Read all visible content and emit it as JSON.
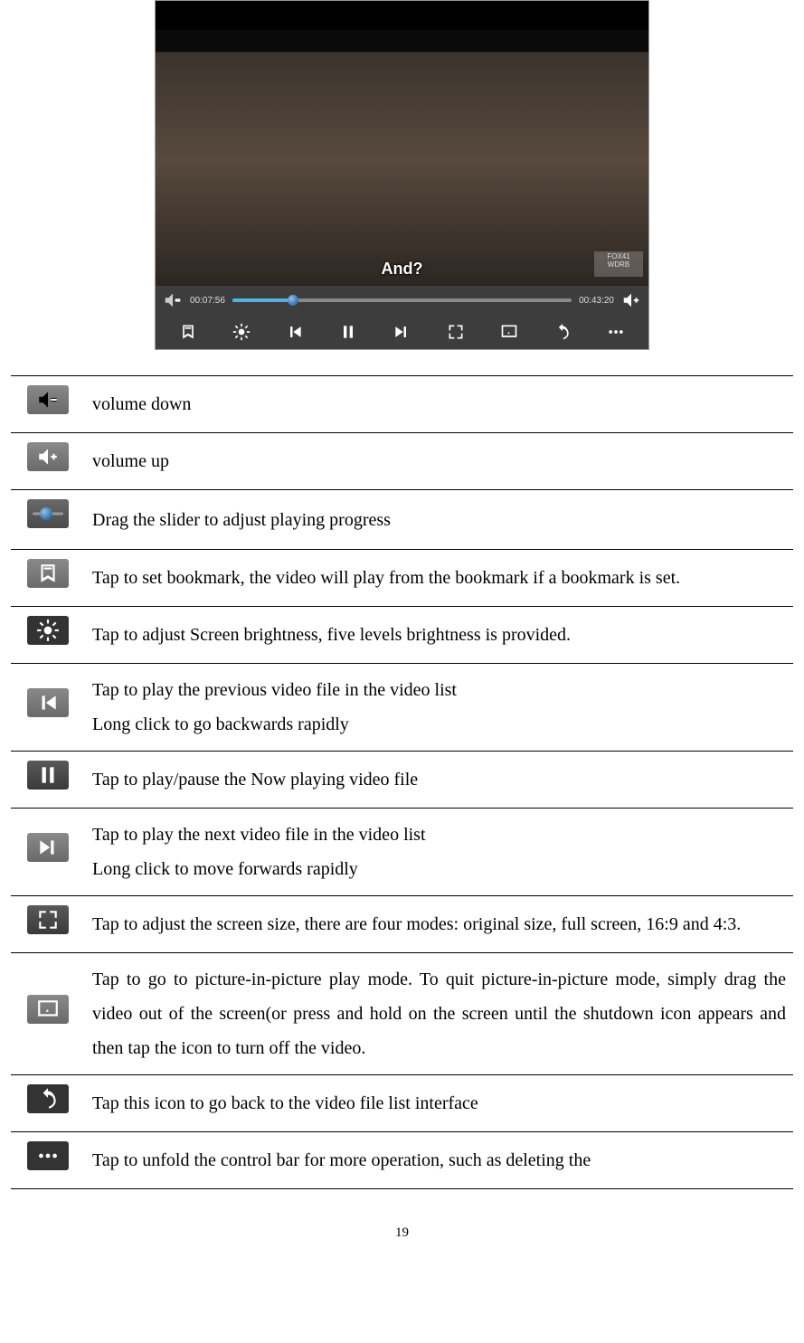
{
  "player": {
    "subtitle": "And?",
    "watermark_line1": "FOX41",
    "watermark_line2": "WDRB",
    "time_current": "00:07:56",
    "time_total": "00:43:20"
  },
  "rows": [
    {
      "icon": "volume-down-icon",
      "desc": "volume down"
    },
    {
      "icon": "volume-up-icon",
      "desc": "volume up"
    },
    {
      "icon": "progress-slider-icon",
      "desc": "Drag the slider to adjust playing progress"
    },
    {
      "icon": "bookmark-icon",
      "desc": "Tap to set bookmark, the video will play from the bookmark if a bookmark is set."
    },
    {
      "icon": "brightness-icon",
      "desc": "Tap to adjust Screen brightness, five levels brightness is provided."
    },
    {
      "icon": "previous-track-icon",
      "desc": "Tap to play the previous video file in the video list\nLong click to go backwards rapidly"
    },
    {
      "icon": "play-pause-icon",
      "desc": "Tap to play/pause the Now playing video file"
    },
    {
      "icon": "next-track-icon",
      "desc": "Tap to play the next video file in the video list\nLong click to move forwards rapidly"
    },
    {
      "icon": "screen-size-icon",
      "desc": "Tap to adjust the screen size, there are four modes: original size, full screen, 16:9 and 4:3."
    },
    {
      "icon": "pip-icon",
      "desc": "Tap to go to picture-in-picture play mode. To quit picture-in-picture mode, simply drag the video out of the screen(or press and hold on the screen until the shutdown icon appears and then tap the icon to turn off the video."
    },
    {
      "icon": "back-to-list-icon",
      "desc": "Tap this icon to go back to the video file list interface"
    },
    {
      "icon": "more-icon",
      "desc": "Tap to unfold the control bar for more operation, such as deleting the"
    }
  ],
  "page_number": "19"
}
